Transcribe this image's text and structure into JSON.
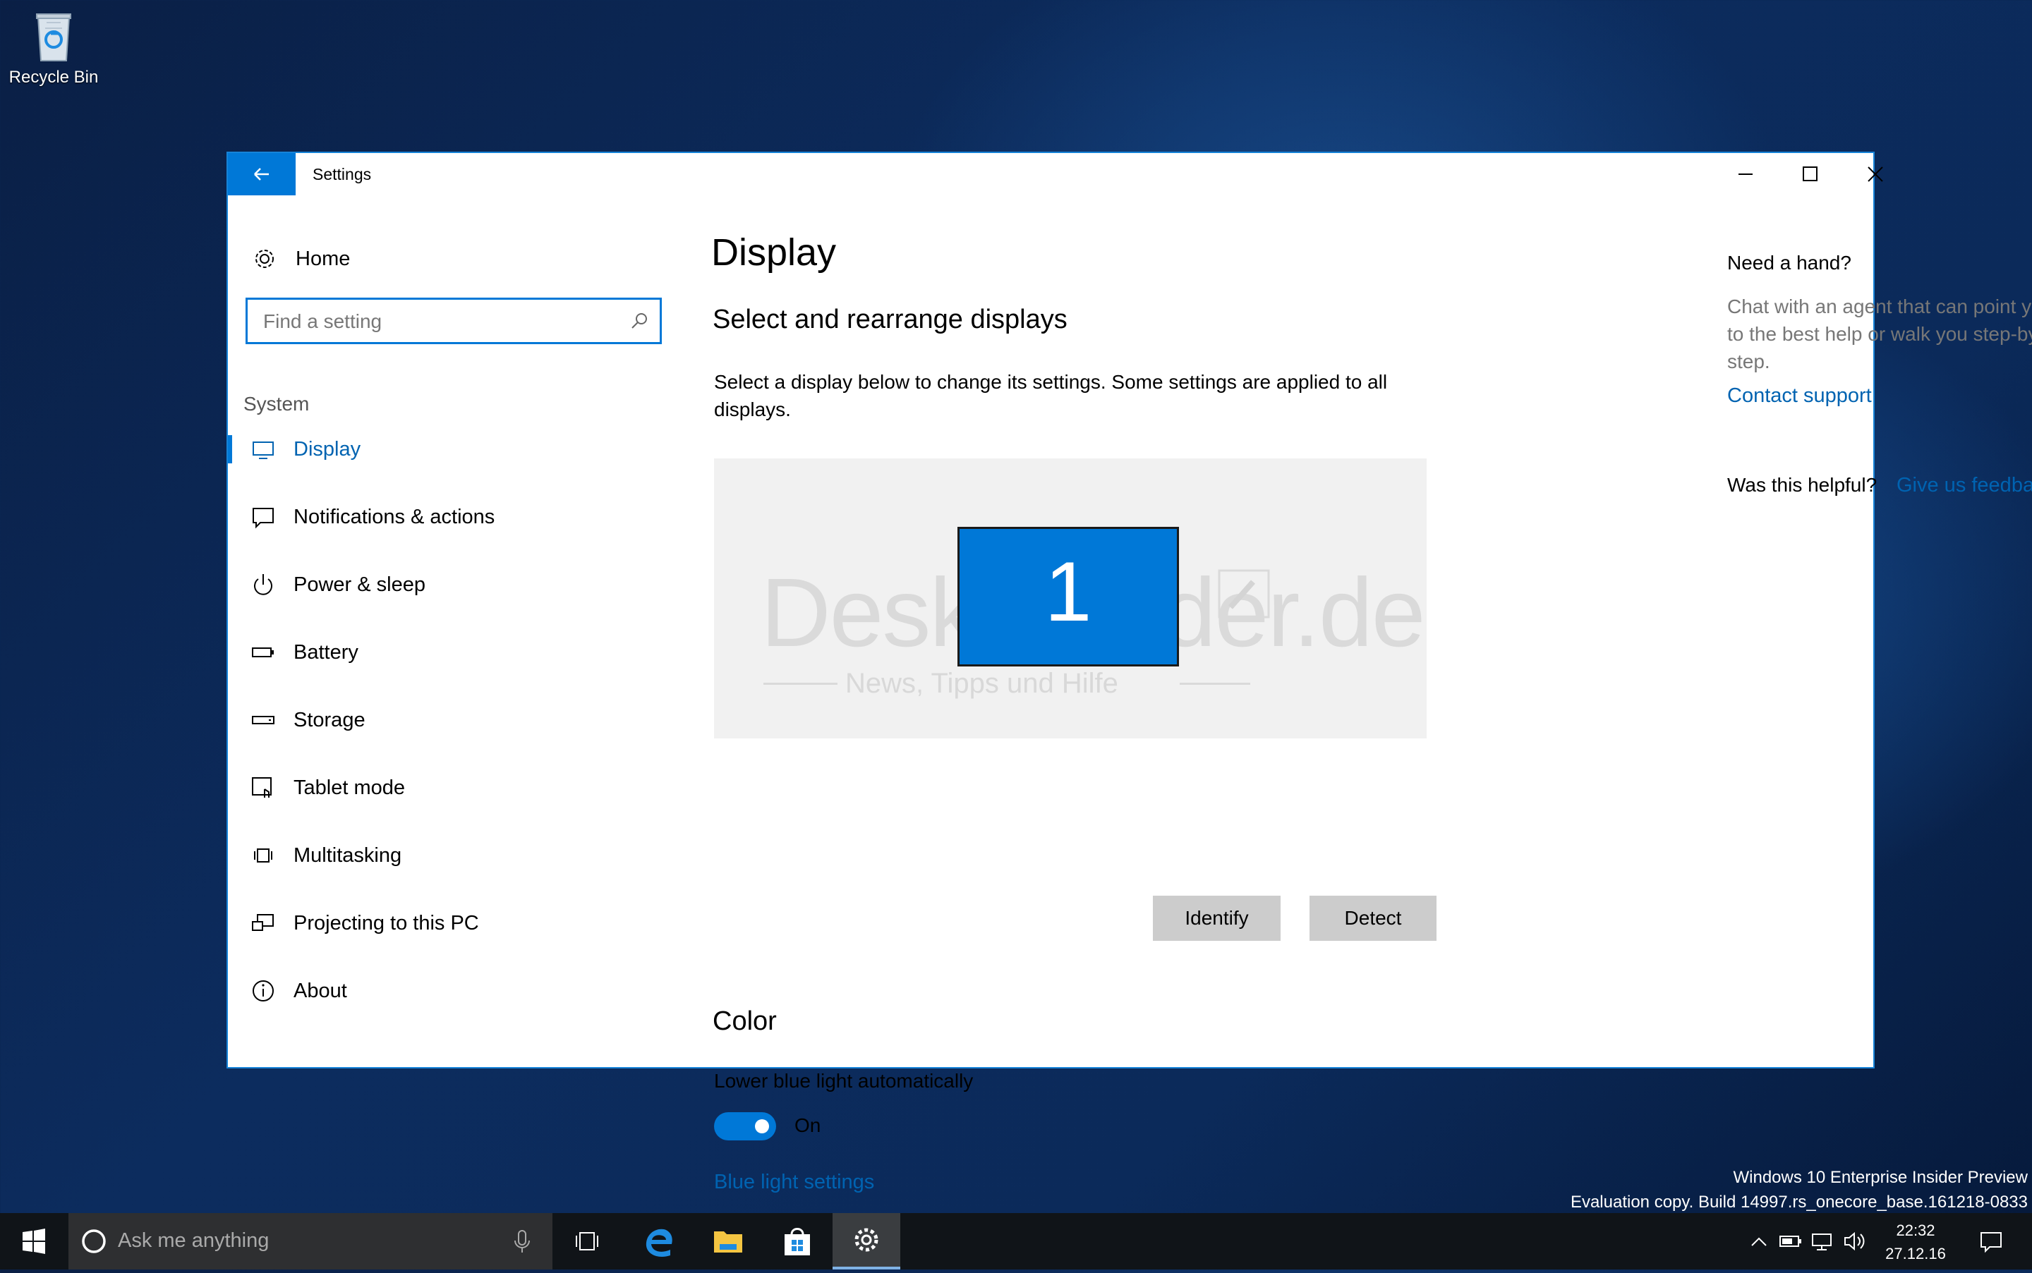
{
  "desktop": {
    "recycle_bin_label": "Recycle Bin"
  },
  "window": {
    "title": "Settings"
  },
  "nav": {
    "home_label": "Home",
    "search_placeholder": "Find a setting",
    "section_label": "System",
    "items": [
      {
        "label": "Display",
        "icon": "monitor-icon",
        "active": true
      },
      {
        "label": "Notifications & actions",
        "icon": "notification-icon"
      },
      {
        "label": "Power & sleep",
        "icon": "power-icon"
      },
      {
        "label": "Battery",
        "icon": "battery-icon"
      },
      {
        "label": "Storage",
        "icon": "storage-icon"
      },
      {
        "label": "Tablet mode",
        "icon": "tablet-mode-icon"
      },
      {
        "label": "Multitasking",
        "icon": "multitasking-icon"
      },
      {
        "label": "Projecting to this PC",
        "icon": "projecting-icon"
      },
      {
        "label": "About",
        "icon": "info-icon"
      }
    ]
  },
  "main": {
    "title": "Display",
    "rearrange_heading": "Select and rearrange displays",
    "rearrange_desc": "Select a display below to change its settings. Some settings are applied to all displays.",
    "monitor_number": "1",
    "watermark": {
      "text": "Deskmodder.de",
      "subtitle": "News, Tipps und Hilfe"
    },
    "identify_label": "Identify",
    "detect_label": "Detect",
    "color_heading": "Color",
    "blue_light_auto_label": "Lower blue light automatically",
    "toggle_state": "On",
    "blue_light_link": "Blue light settings"
  },
  "aside": {
    "need_hand": "Need a hand?",
    "help_text": "Chat with an agent that can point you to the best help or walk you step-by-step.",
    "contact_support": "Contact support",
    "was_helpful": "Was this helpful?",
    "feedback_link": "Give us feedback"
  },
  "system_info": {
    "edition": "Windows 10 Enterprise Insider Preview",
    "build": "Evaluation copy. Build 14997.rs_onecore_base.161218-0833"
  },
  "taskbar": {
    "search_placeholder": "Ask me anything",
    "time": "22:32",
    "date": "27.12.16"
  },
  "colors": {
    "accent": "#0078d7",
    "link": "#0063b1",
    "taskbar": "#101418"
  }
}
